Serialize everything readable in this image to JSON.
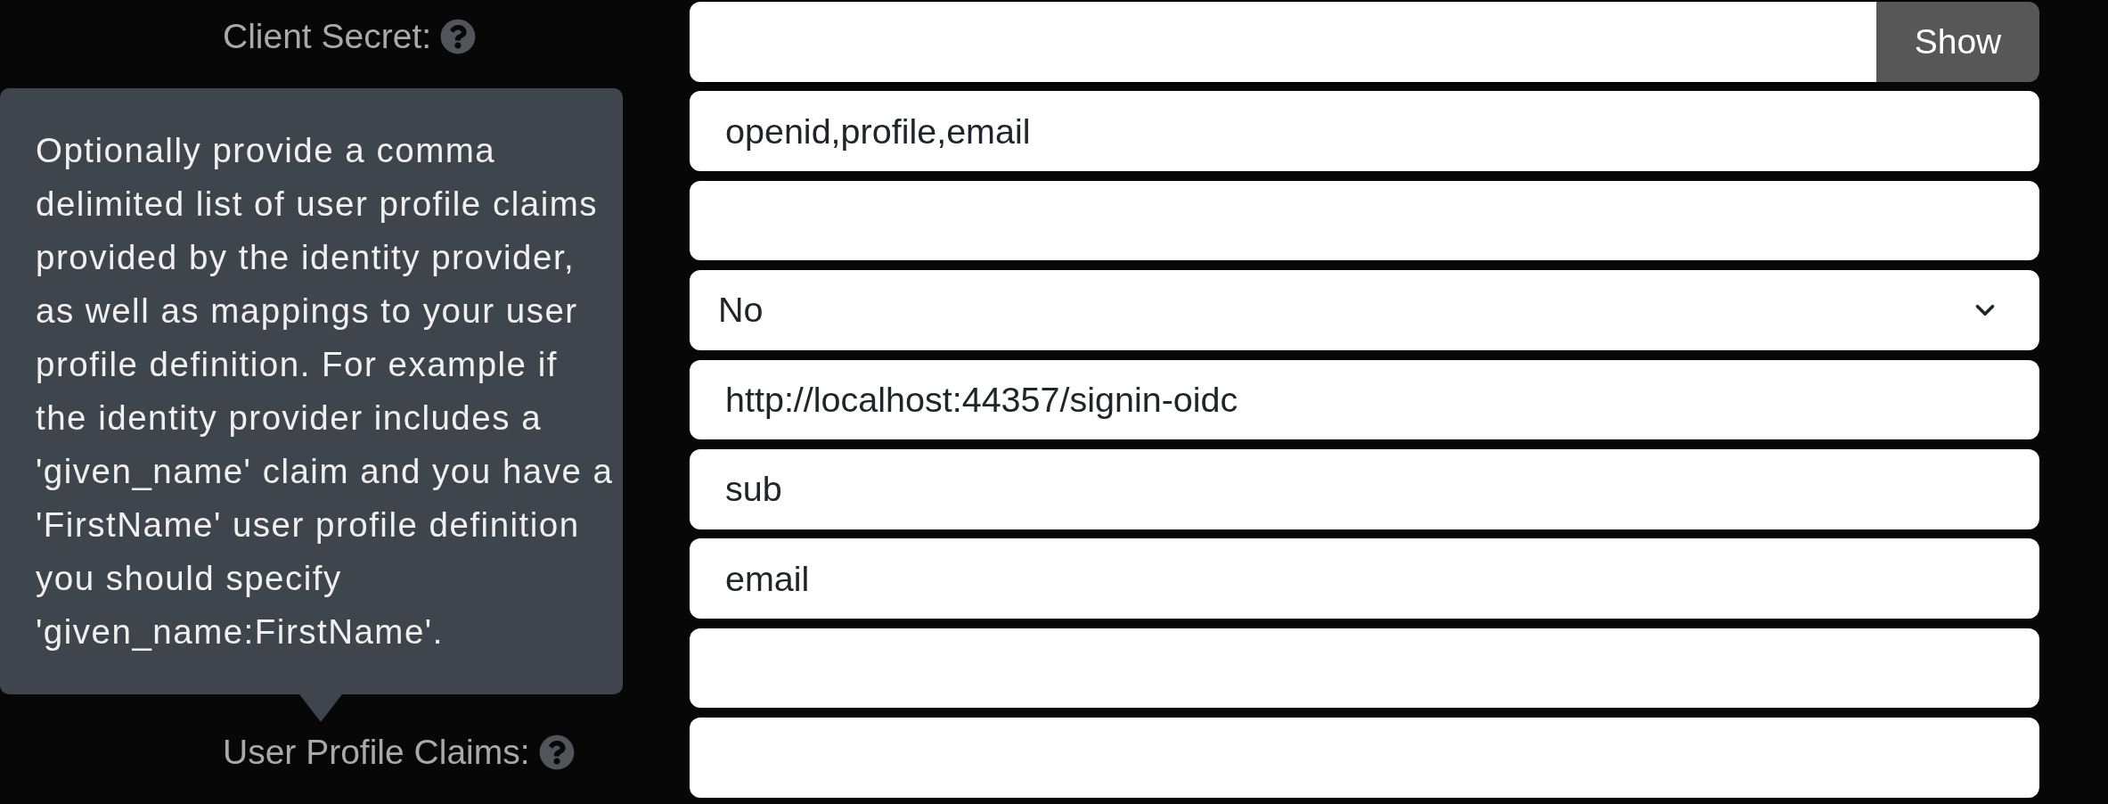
{
  "fields": [
    {
      "kind": "secret",
      "label": "Client Secret:",
      "button": "Show"
    },
    {
      "kind": "text",
      "value": "openid,profile,email"
    },
    {
      "kind": "text"
    },
    {
      "kind": "select",
      "value": "No"
    },
    {
      "kind": "text",
      "value": "http://localhost:44357/signin-oidc"
    },
    {
      "kind": "text",
      "value": "sub"
    },
    {
      "kind": "text",
      "value": "email"
    },
    {
      "kind": "text"
    },
    {
      "kind": "text",
      "label": "User Profile Claims:"
    }
  ],
  "tooltip": {
    "text": "Optionally provide a comma delimited list of user profile claims provided by the identity provider, as well as mappings to your user profile definition. For example if the identity provider includes a 'given_name' claim and you have a 'FirstName' user profile definition you should specify 'given_name:FirstName'."
  }
}
